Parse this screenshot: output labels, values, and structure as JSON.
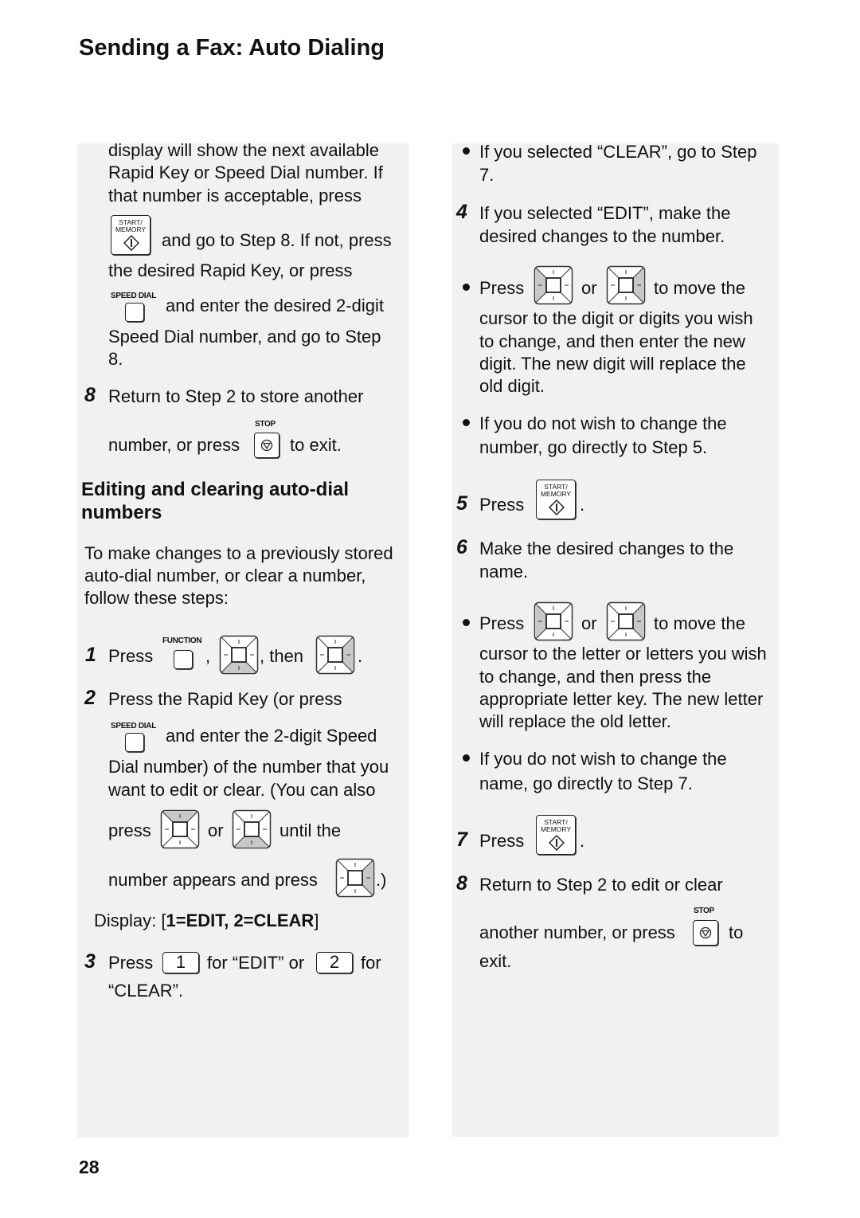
{
  "header": {
    "title": "Sending a Fax: Auto Dialing"
  },
  "footer": {
    "page_number": "28"
  },
  "keys": {
    "start_memory": "START/\nMEMORY",
    "start_line1": "START/",
    "start_line2": "MEMORY",
    "speed_dial": "SPEED DIAL",
    "stop": "STOP",
    "function": "FUNCTION",
    "digit_1": "1",
    "digit_2": "2"
  },
  "left": {
    "cont_lines": [
      "display will show the next available",
      "Rapid Key or Speed Dial number. If",
      "that number is acceptable, press",
      "and go to Step 8. If not, press",
      "the desired Rapid Key, or press",
      "and enter the desired 2-digit",
      "Speed Dial number, and go to Step",
      "8."
    ],
    "step8": {
      "num": "8",
      "line1": "Return to Step 2 to store another",
      "line2a": "number, or press",
      "line2b": "to exit."
    },
    "section_heading_line1": "Editing and clearing auto-dial",
    "section_heading_line2": "numbers",
    "intro_lines": [
      "To make changes to a previously stored",
      "auto-dial number, or clear a number,",
      "follow these steps:"
    ],
    "step1": {
      "num": "1",
      "press": "Press",
      "comma": ",",
      "then": ", then",
      "period": "."
    },
    "step2": {
      "num": "2",
      "line1": "Press the Rapid Key (or press",
      "line2": "and enter the 2-digit Speed",
      "line3": "Dial number) of the number that you",
      "line4": "want to edit or clear. (You can also",
      "line5a": "press",
      "line5b": "or",
      "line5c": "until the",
      "line6a": "number appears and press",
      "line6b": ".)"
    },
    "display": {
      "prefix": "Display: [",
      "value": "1=EDIT, 2=CLEAR",
      "suffix": "]"
    },
    "step3": {
      "num": "3",
      "press": "Press",
      "mid": "for “EDIT” or",
      "end": "for",
      "line2": "“CLEAR”."
    }
  },
  "right": {
    "bullet_clear": [
      "If you selected “CLEAR”, go to Step",
      "7."
    ],
    "step4": {
      "num": "4",
      "lines": [
        "If you selected “EDIT”, make the",
        "desired changes to the number."
      ]
    },
    "bullet_move_digit": {
      "press": "Press",
      "or": "or",
      "to_move": "to move the",
      "lines": [
        "cursor to the digit or digits you wish",
        "to change, and then enter the new",
        "digit. The new digit will replace the",
        "old digit."
      ]
    },
    "bullet_no_change_number": [
      "If you do not wish to change the",
      "number, go directly to Step 5."
    ],
    "step5": {
      "num": "5",
      "press": "Press",
      "period": "."
    },
    "step6": {
      "num": "6",
      "lines": [
        "Make the desired changes to the",
        "name."
      ]
    },
    "bullet_move_letter": {
      "press": "Press",
      "or": "or",
      "to_move": "to move the",
      "lines": [
        "cursor to the letter or letters you wish",
        "to change, and then press the",
        "appropriate letter key. The new letter",
        "will replace the old letter."
      ]
    },
    "bullet_no_change_name": [
      "If you do not wish to change the",
      "name, go directly to Step 7."
    ],
    "step7": {
      "num": "7",
      "press": "Press",
      "period": "."
    },
    "step8": {
      "num": "8",
      "line1": "Return to Step 2 to edit or clear",
      "line2a": "another number, or press",
      "line2b": "to",
      "line3": "exit."
    }
  }
}
